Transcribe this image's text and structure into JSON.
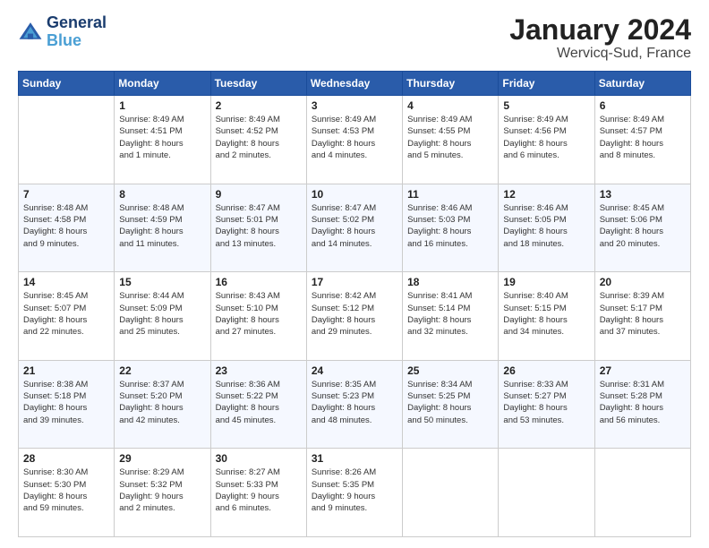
{
  "logo": {
    "line1": "General",
    "line2": "Blue"
  },
  "title": "January 2024",
  "subtitle": "Wervicq-Sud, France",
  "header": {
    "days": [
      "Sunday",
      "Monday",
      "Tuesday",
      "Wednesday",
      "Thursday",
      "Friday",
      "Saturday"
    ]
  },
  "weeks": [
    [
      {
        "day": "",
        "sunrise": "",
        "sunset": "",
        "daylight": ""
      },
      {
        "day": "1",
        "sunrise": "Sunrise: 8:49 AM",
        "sunset": "Sunset: 4:51 PM",
        "daylight": "Daylight: 8 hours and 1 minute."
      },
      {
        "day": "2",
        "sunrise": "Sunrise: 8:49 AM",
        "sunset": "Sunset: 4:52 PM",
        "daylight": "Daylight: 8 hours and 2 minutes."
      },
      {
        "day": "3",
        "sunrise": "Sunrise: 8:49 AM",
        "sunset": "Sunset: 4:53 PM",
        "daylight": "Daylight: 8 hours and 4 minutes."
      },
      {
        "day": "4",
        "sunrise": "Sunrise: 8:49 AM",
        "sunset": "Sunset: 4:55 PM",
        "daylight": "Daylight: 8 hours and 5 minutes."
      },
      {
        "day": "5",
        "sunrise": "Sunrise: 8:49 AM",
        "sunset": "Sunset: 4:56 PM",
        "daylight": "Daylight: 8 hours and 6 minutes."
      },
      {
        "day": "6",
        "sunrise": "Sunrise: 8:49 AM",
        "sunset": "Sunset: 4:57 PM",
        "daylight": "Daylight: 8 hours and 8 minutes."
      }
    ],
    [
      {
        "day": "7",
        "sunrise": "Sunrise: 8:48 AM",
        "sunset": "Sunset: 4:58 PM",
        "daylight": "Daylight: 8 hours and 9 minutes."
      },
      {
        "day": "8",
        "sunrise": "Sunrise: 8:48 AM",
        "sunset": "Sunset: 4:59 PM",
        "daylight": "Daylight: 8 hours and 11 minutes."
      },
      {
        "day": "9",
        "sunrise": "Sunrise: 8:47 AM",
        "sunset": "Sunset: 5:01 PM",
        "daylight": "Daylight: 8 hours and 13 minutes."
      },
      {
        "day": "10",
        "sunrise": "Sunrise: 8:47 AM",
        "sunset": "Sunset: 5:02 PM",
        "daylight": "Daylight: 8 hours and 14 minutes."
      },
      {
        "day": "11",
        "sunrise": "Sunrise: 8:46 AM",
        "sunset": "Sunset: 5:03 PM",
        "daylight": "Daylight: 8 hours and 16 minutes."
      },
      {
        "day": "12",
        "sunrise": "Sunrise: 8:46 AM",
        "sunset": "Sunset: 5:05 PM",
        "daylight": "Daylight: 8 hours and 18 minutes."
      },
      {
        "day": "13",
        "sunrise": "Sunrise: 8:45 AM",
        "sunset": "Sunset: 5:06 PM",
        "daylight": "Daylight: 8 hours and 20 minutes."
      }
    ],
    [
      {
        "day": "14",
        "sunrise": "Sunrise: 8:45 AM",
        "sunset": "Sunset: 5:07 PM",
        "daylight": "Daylight: 8 hours and 22 minutes."
      },
      {
        "day": "15",
        "sunrise": "Sunrise: 8:44 AM",
        "sunset": "Sunset: 5:09 PM",
        "daylight": "Daylight: 8 hours and 25 minutes."
      },
      {
        "day": "16",
        "sunrise": "Sunrise: 8:43 AM",
        "sunset": "Sunset: 5:10 PM",
        "daylight": "Daylight: 8 hours and 27 minutes."
      },
      {
        "day": "17",
        "sunrise": "Sunrise: 8:42 AM",
        "sunset": "Sunset: 5:12 PM",
        "daylight": "Daylight: 8 hours and 29 minutes."
      },
      {
        "day": "18",
        "sunrise": "Sunrise: 8:41 AM",
        "sunset": "Sunset: 5:14 PM",
        "daylight": "Daylight: 8 hours and 32 minutes."
      },
      {
        "day": "19",
        "sunrise": "Sunrise: 8:40 AM",
        "sunset": "Sunset: 5:15 PM",
        "daylight": "Daylight: 8 hours and 34 minutes."
      },
      {
        "day": "20",
        "sunrise": "Sunrise: 8:39 AM",
        "sunset": "Sunset: 5:17 PM",
        "daylight": "Daylight: 8 hours and 37 minutes."
      }
    ],
    [
      {
        "day": "21",
        "sunrise": "Sunrise: 8:38 AM",
        "sunset": "Sunset: 5:18 PM",
        "daylight": "Daylight: 8 hours and 39 minutes."
      },
      {
        "day": "22",
        "sunrise": "Sunrise: 8:37 AM",
        "sunset": "Sunset: 5:20 PM",
        "daylight": "Daylight: 8 hours and 42 minutes."
      },
      {
        "day": "23",
        "sunrise": "Sunrise: 8:36 AM",
        "sunset": "Sunset: 5:22 PM",
        "daylight": "Daylight: 8 hours and 45 minutes."
      },
      {
        "day": "24",
        "sunrise": "Sunrise: 8:35 AM",
        "sunset": "Sunset: 5:23 PM",
        "daylight": "Daylight: 8 hours and 48 minutes."
      },
      {
        "day": "25",
        "sunrise": "Sunrise: 8:34 AM",
        "sunset": "Sunset: 5:25 PM",
        "daylight": "Daylight: 8 hours and 50 minutes."
      },
      {
        "day": "26",
        "sunrise": "Sunrise: 8:33 AM",
        "sunset": "Sunset: 5:27 PM",
        "daylight": "Daylight: 8 hours and 53 minutes."
      },
      {
        "day": "27",
        "sunrise": "Sunrise: 8:31 AM",
        "sunset": "Sunset: 5:28 PM",
        "daylight": "Daylight: 8 hours and 56 minutes."
      }
    ],
    [
      {
        "day": "28",
        "sunrise": "Sunrise: 8:30 AM",
        "sunset": "Sunset: 5:30 PM",
        "daylight": "Daylight: 8 hours and 59 minutes."
      },
      {
        "day": "29",
        "sunrise": "Sunrise: 8:29 AM",
        "sunset": "Sunset: 5:32 PM",
        "daylight": "Daylight: 9 hours and 2 minutes."
      },
      {
        "day": "30",
        "sunrise": "Sunrise: 8:27 AM",
        "sunset": "Sunset: 5:33 PM",
        "daylight": "Daylight: 9 hours and 6 minutes."
      },
      {
        "day": "31",
        "sunrise": "Sunrise: 8:26 AM",
        "sunset": "Sunset: 5:35 PM",
        "daylight": "Daylight: 9 hours and 9 minutes."
      },
      {
        "day": "",
        "sunrise": "",
        "sunset": "",
        "daylight": ""
      },
      {
        "day": "",
        "sunrise": "",
        "sunset": "",
        "daylight": ""
      },
      {
        "day": "",
        "sunrise": "",
        "sunset": "",
        "daylight": ""
      }
    ]
  ]
}
